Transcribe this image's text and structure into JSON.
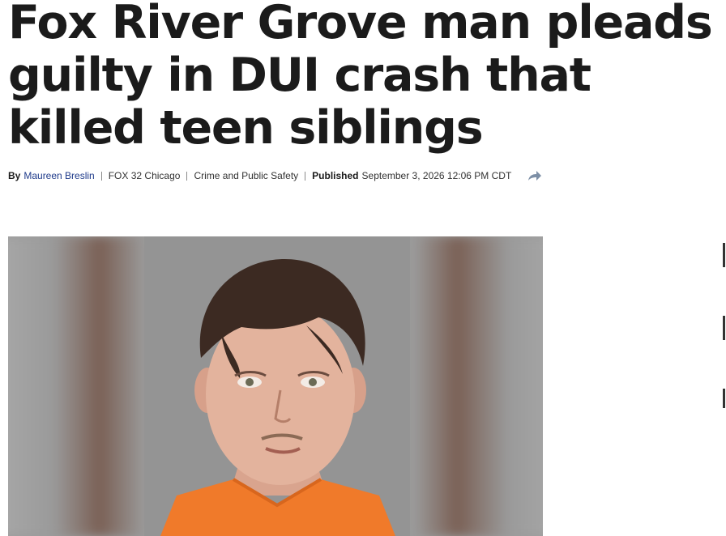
{
  "article": {
    "headline": "Fox River Grove man pleads guilty in DUI crash that killed teen siblings",
    "byline": {
      "by_label": "By",
      "author": "Maureen Breslin",
      "outlet": "FOX 32 Chicago",
      "category": "Crime and Public Safety",
      "published_label": "Published",
      "published_date": "September 3, 2026 12:06 PM CDT"
    },
    "share_icon": "share-arrow-icon",
    "image": {
      "alt": "booking photo of a young man in an orange jumpsuit"
    }
  },
  "colors": {
    "headline": "#1b1b1b",
    "author_link": "#1e3a8a",
    "jumpsuit": "#f07a2a"
  }
}
